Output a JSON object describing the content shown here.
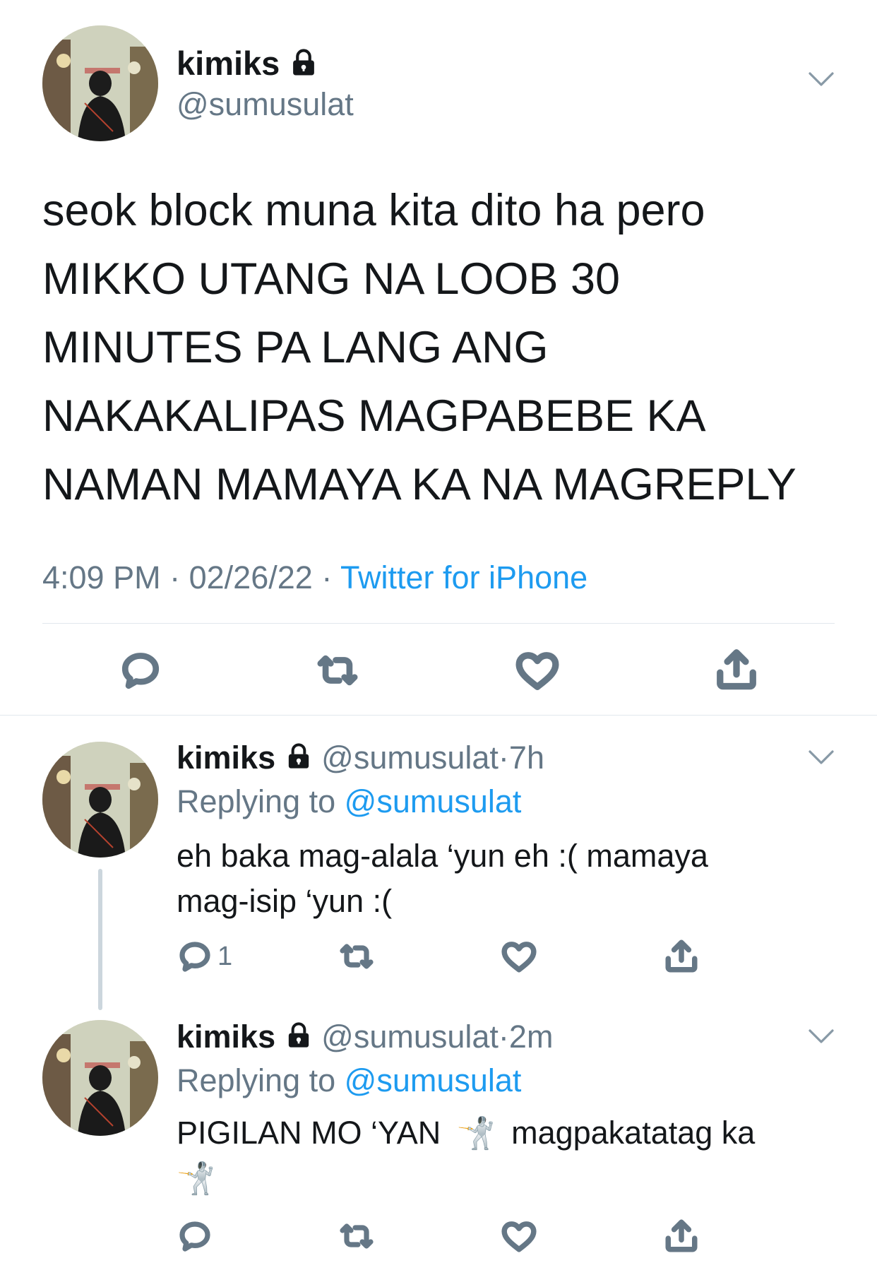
{
  "main_tweet": {
    "display_name": "kimiks",
    "handle": "@sumusulat",
    "text_lines": [
      "seok block muna kita dito ha pero",
      "MIKKO UTANG NA LOOB 30",
      "MINUTES PA LANG ANG",
      "NAKAKALIPAS MAGPABEBE KA",
      "NAMAN MAMAYA KA NA MAGREPLY"
    ],
    "time": "4:09 PM",
    "date": "02/26/22",
    "separator": "·",
    "source": "Twitter for iPhone"
  },
  "replies": [
    {
      "display_name": "kimiks",
      "handle": "@sumusulat",
      "dot": "·",
      "age": "7h",
      "replying_prefix": "Replying to",
      "replying_handle": "@sumusulat",
      "text_lines": [
        "eh baka mag-alala ‘yun eh :( mamaya",
        "mag-isip ‘yun :("
      ],
      "reply_count": "1"
    },
    {
      "display_name": "kimiks",
      "handle": "@sumusulat",
      "dot": "·",
      "age": "2m",
      "replying_prefix": "Replying to",
      "replying_handle": "@sumusulat",
      "text_part1": "PIGILAN MO ‘YAN",
      "text_part2": "magpakatatag ka",
      "emoji": "🤺"
    }
  ],
  "icons": {
    "lock": "lock-icon",
    "chevron": "chevron-down-icon",
    "reply": "reply-icon",
    "retweet": "retweet-icon",
    "like": "like-icon",
    "share": "share-icon"
  }
}
